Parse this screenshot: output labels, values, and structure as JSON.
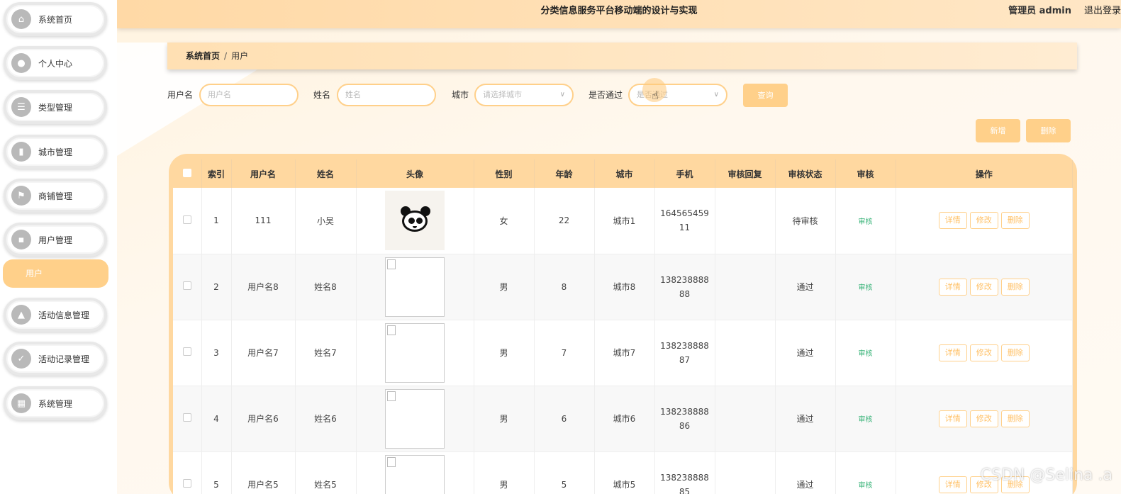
{
  "header": {
    "title": "分类信息服务平台移动端的设计与实现",
    "user": "管理员 admin",
    "logout": "退出登录"
  },
  "sidebar": {
    "items": [
      {
        "label": "系统首页",
        "icon": "home-icon"
      },
      {
        "label": "个人中心",
        "icon": "person-icon"
      },
      {
        "label": "类型管理",
        "icon": "list-icon"
      },
      {
        "label": "城市管理",
        "icon": "building-icon"
      },
      {
        "label": "商铺管理",
        "icon": "flag-icon"
      },
      {
        "label": "用户管理",
        "icon": "chat-icon"
      },
      {
        "label": "活动信息管理",
        "icon": "user-card-icon"
      },
      {
        "label": "活动记录管理",
        "icon": "clipboard-icon"
      },
      {
        "label": "系统管理",
        "icon": "grid-icon"
      }
    ],
    "active_sub": "用户"
  },
  "breadcrumb": {
    "home": "系统首页",
    "sep": "/",
    "current": "用户"
  },
  "filters": {
    "username_label": "用户名",
    "username_placeholder": "用户名",
    "name_label": "姓名",
    "name_placeholder": "姓名",
    "city_label": "城市",
    "city_placeholder": "请选择城市",
    "pass_label": "是否通过",
    "pass_placeholder": "是否通过",
    "search": "查询"
  },
  "actions": {
    "add": "新增",
    "delete": "删除"
  },
  "table": {
    "columns": [
      "索引",
      "用户名",
      "姓名",
      "头像",
      "性别",
      "年龄",
      "城市",
      "手机",
      "审核回复",
      "审核状态",
      "审核",
      "操作"
    ],
    "rows": [
      {
        "index": "1",
        "username": "111",
        "name": "小吴",
        "avatar": "panda",
        "gender": "女",
        "age": "22",
        "city": "城市1",
        "phone1": "164565459",
        "phone2": "11",
        "reply": "",
        "status": "待审核",
        "audit": "审核"
      },
      {
        "index": "2",
        "username": "用户名8",
        "name": "姓名8",
        "avatar": "broken",
        "gender": "男",
        "age": "8",
        "city": "城市8",
        "phone1": "138238888",
        "phone2": "88",
        "reply": "",
        "status": "通过",
        "audit": "审核"
      },
      {
        "index": "3",
        "username": "用户名7",
        "name": "姓名7",
        "avatar": "broken",
        "gender": "男",
        "age": "7",
        "city": "城市7",
        "phone1": "138238888",
        "phone2": "87",
        "reply": "",
        "status": "通过",
        "audit": "审核"
      },
      {
        "index": "4",
        "username": "用户名6",
        "name": "姓名6",
        "avatar": "broken",
        "gender": "男",
        "age": "6",
        "city": "城市6",
        "phone1": "138238888",
        "phone2": "86",
        "reply": "",
        "status": "通过",
        "audit": "审核"
      },
      {
        "index": "5",
        "username": "用户名5",
        "name": "姓名5",
        "avatar": "broken",
        "gender": "男",
        "age": "5",
        "city": "城市5",
        "phone1": "138238888",
        "phone2": "85",
        "reply": "",
        "status": "通过",
        "audit": "审核"
      }
    ],
    "ops": {
      "detail": "详情",
      "edit": "修改",
      "delete": "删除"
    }
  },
  "watermark": "CSDN @Selina .a",
  "colors": {
    "accent": "#ffd08a",
    "header": "#ffd9a6",
    "audit": "#3bb47a"
  }
}
